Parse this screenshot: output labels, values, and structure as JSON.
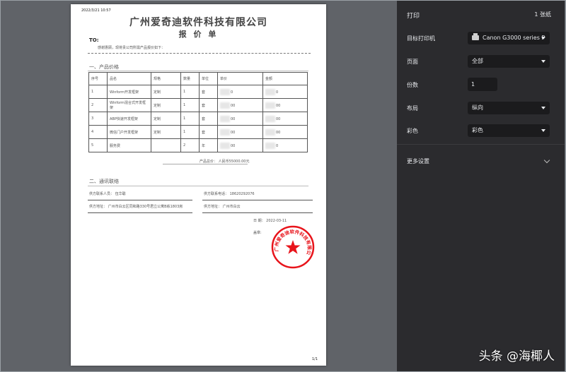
{
  "document": {
    "print_date": "2022/3/21 10:57",
    "company": "广州爱奇迪软件科技有限公司",
    "title": "报 价 单",
    "to_label": "TO:",
    "greeting": "感谢惠顾，现将贵公司所需产品报价如下：",
    "section_products": "一、产品价格",
    "table": {
      "headers": [
        "序号",
        "品名",
        "规格",
        "数量",
        "单位",
        "单价",
        "金额"
      ],
      "rows": [
        [
          "1",
          "Winform开发框架",
          "定制",
          "1",
          "套",
          "0",
          "0"
        ],
        [
          "2",
          "Winform混合式开发框架",
          "定制",
          "1",
          "套",
          "00",
          "00"
        ],
        [
          "3",
          "ABP快速开发框架",
          "定制",
          "1",
          "套",
          "00",
          "00"
        ],
        [
          "4",
          "微信门户开发框架",
          "定制",
          "1",
          "套",
          "00",
          "00"
        ],
        [
          "5",
          "服务费",
          "",
          "2",
          "年",
          "00",
          "0"
        ]
      ]
    },
    "total": "产品总价：  人民币55000.00元",
    "section_contact": "二、通讯联络",
    "contact_person": "供方联系人员：  伍华聪",
    "contact_phone": "供方联系电话：  18620292076",
    "address_left": "供方地址：  广州市白云区同和路330号君立公寓B栋1803房",
    "address_right": "供方地址：  广州市白云",
    "date_line": "日  期：  2022-03-11",
    "stamp_label": "盖章:",
    "seal_text": "广州爱奇迪软件科技有限公司",
    "page_number": "1/1"
  },
  "print_panel": {
    "title": "打印",
    "sheets": "1 张纸",
    "destination_label": "目标打印机",
    "destination_value": "Canon G3000 series P",
    "pages_label": "页面",
    "pages_value": "全部",
    "copies_label": "份数",
    "copies_value": "1",
    "layout_label": "布局",
    "layout_value": "纵向",
    "color_label": "彩色",
    "color_value": "彩色",
    "more_settings": "更多设置"
  },
  "watermark": "头条 @海椰人",
  "colors": {
    "panel_bg": "#2b2b2e",
    "input_bg": "#1b1b1d",
    "seal_red": "#e8141b",
    "preview_bg": "#606368"
  }
}
